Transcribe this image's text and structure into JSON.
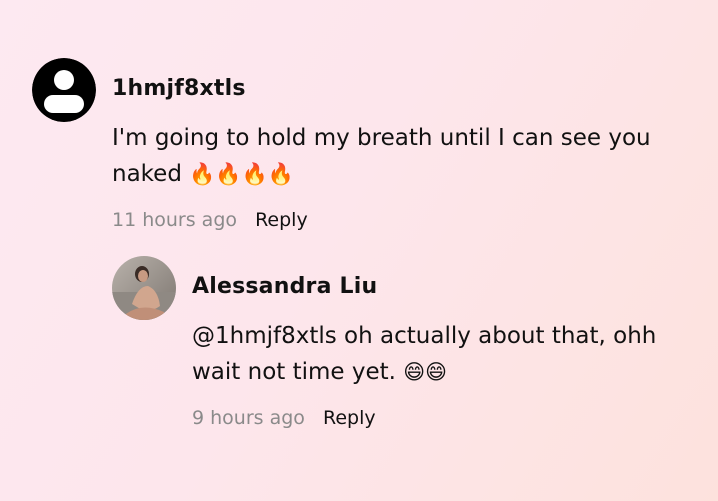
{
  "comments": [
    {
      "username": "1hmjf8xtls",
      "text": "I'm going to hold my breath until I can see you naked",
      "emoji": "🔥🔥🔥🔥",
      "time": "11 hours ago",
      "reply_label": "Reply",
      "avatar_icon": "default-user-icon"
    },
    {
      "username": "Alessandra Liu",
      "text": "@1hmjf8xtls oh actually about that, ohh wait not time yet.",
      "emoji": "😄😄",
      "time": "9 hours ago",
      "reply_label": "Reply",
      "avatar_icon": "profile-photo"
    }
  ]
}
